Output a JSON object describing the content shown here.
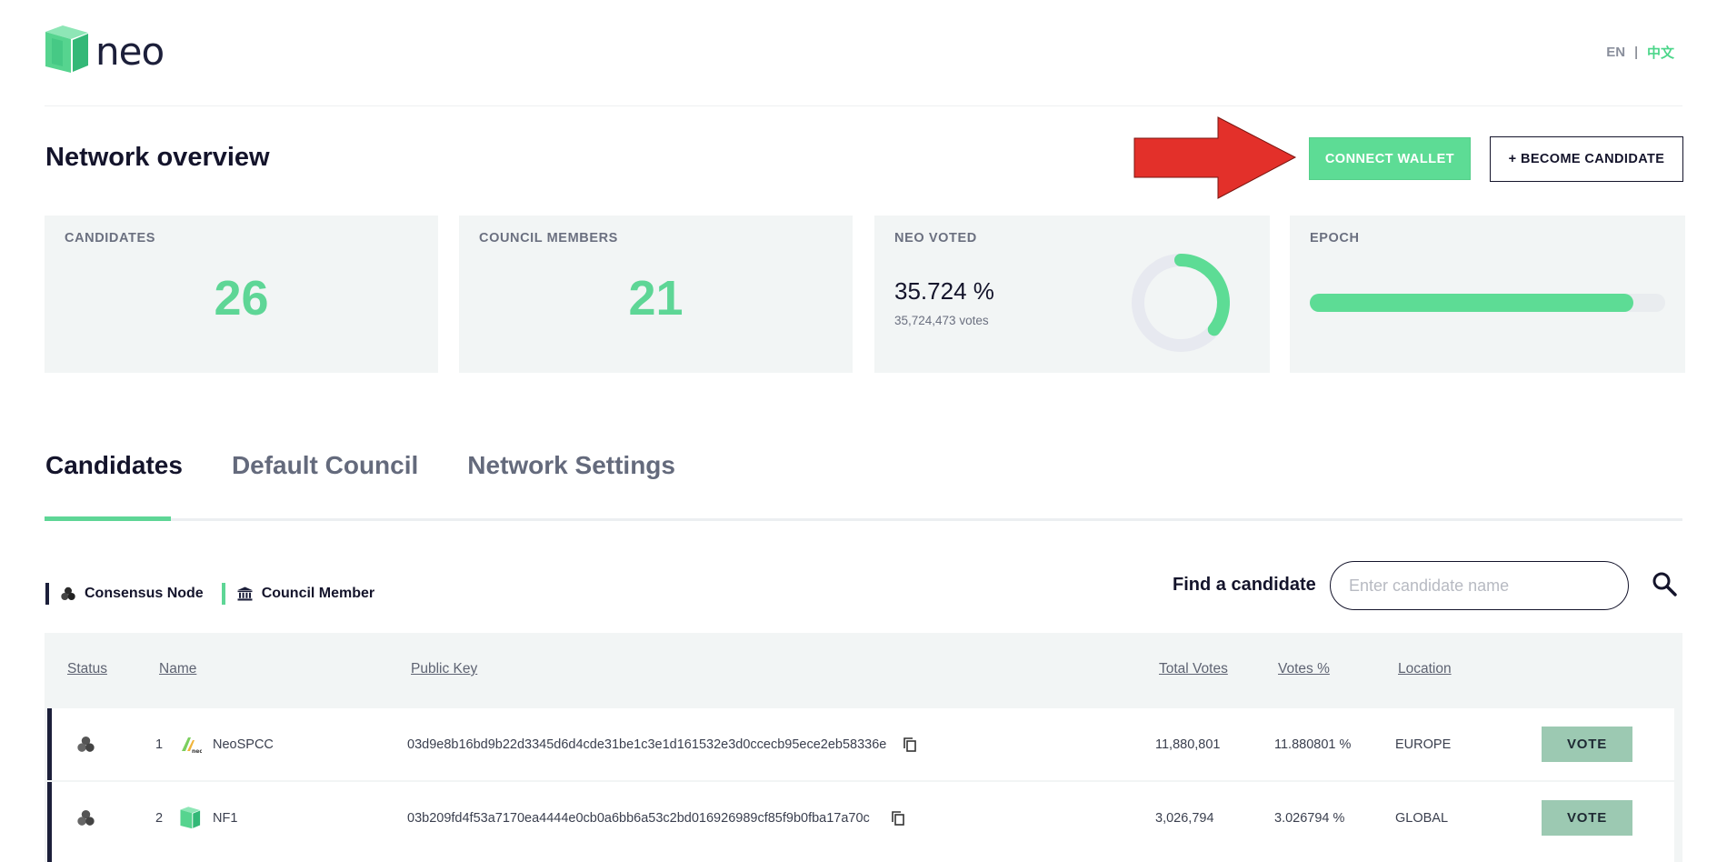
{
  "header": {
    "logo_text": "neo",
    "lang_en": "EN",
    "lang_sep": "|",
    "lang_zh": "中文"
  },
  "title_row": {
    "page_title": "Network overview",
    "connect_wallet": "CONNECT WALLET",
    "become_candidate": "+ BECOME CANDIDATE"
  },
  "stats": {
    "candidates_label": "CANDIDATES",
    "candidates_value": "26",
    "council_label": "COUNCIL MEMBERS",
    "council_value": "21",
    "neo_voted_label": "NEO VOTED",
    "neo_voted_percent": "35.724 %",
    "neo_voted_votes": "35,724,473 votes",
    "neo_voted_fraction": 0.35724,
    "epoch_label": "EPOCH",
    "epoch_progress": 0.91
  },
  "tabs": [
    "Candidates",
    "Default Council",
    "Network Settings"
  ],
  "legend": {
    "consensus": "Consensus Node",
    "council": "Council Member"
  },
  "search": {
    "label": "Find a candidate",
    "placeholder": "Enter candidate name"
  },
  "table": {
    "headers": {
      "status": "Status",
      "name": "Name",
      "public_key": "Public Key",
      "total_votes": "Total Votes",
      "votes_pct": "Votes %",
      "location": "Location"
    },
    "rows": [
      {
        "rank": "1",
        "name": "NeoSPCC",
        "public_key": "03d9e8b16bd9b22d3345d6d4cde31be1c3e1d161532e3d0ccecb95ece2eb58336e",
        "total_votes": "11,880,801",
        "votes_pct": "11.880801 %",
        "location": "EUROPE",
        "vote": "VOTE"
      },
      {
        "rank": "2",
        "name": "NF1",
        "public_key": "03b209fd4f53a7170ea4444e0cb0a6bb6a53c2bd016926989cf85f9b0fba17a70c",
        "total_votes": "3,026,794",
        "votes_pct": "3.026794 %",
        "location": "GLOBAL",
        "vote": "VOTE"
      }
    ]
  },
  "colors": {
    "accent_green": "#5ddc95",
    "navy": "#14142b",
    "panel": "#f2f5f5",
    "arrow_red": "#e3302a"
  }
}
